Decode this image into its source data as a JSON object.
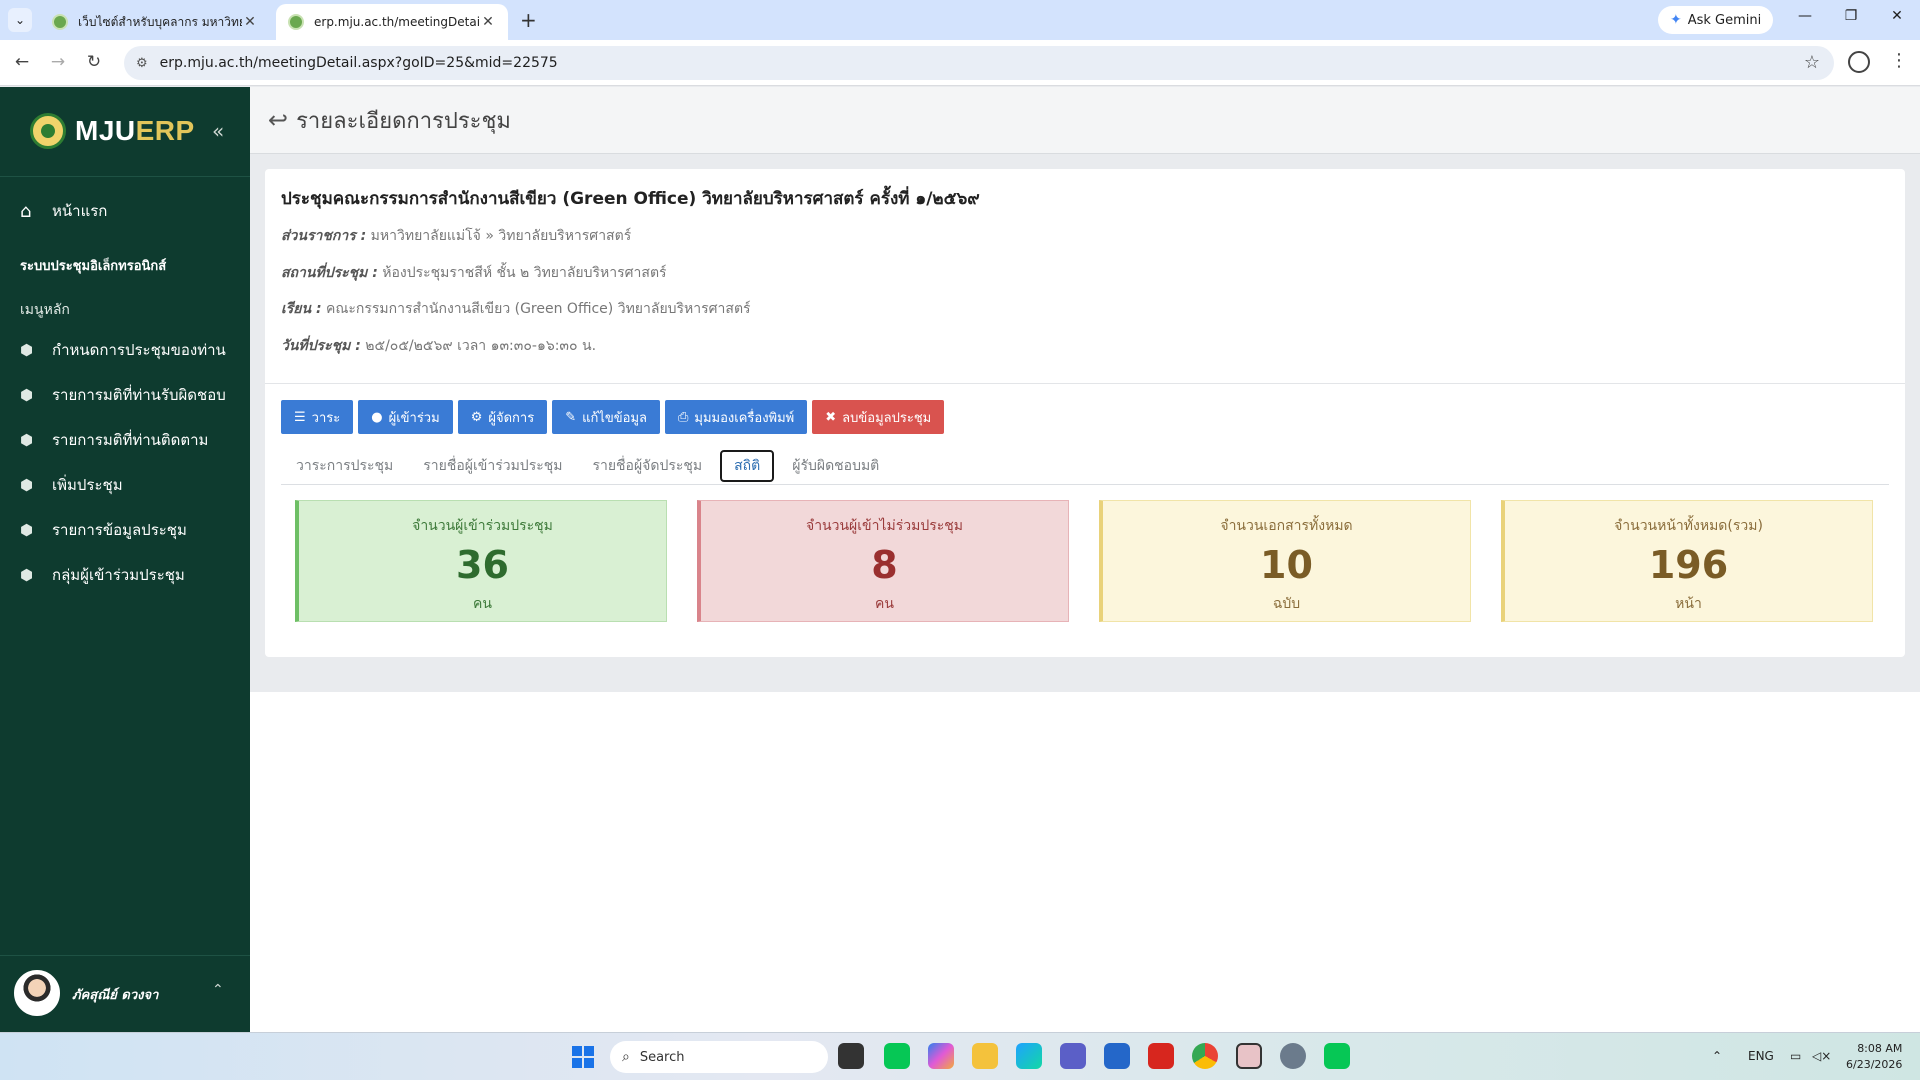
{
  "browser": {
    "tabs": [
      {
        "title": "เว็บไซต์สำหรับบุคลากร มหาวิทยาลัยแม่โจ้"
      },
      {
        "title": "erp.mju.ac.th/meetingDetail.aspx"
      }
    ],
    "url": "erp.mju.ac.th/meetingDetail.aspx?goID=25&mid=22575",
    "ask_gemini": "Ask Gemini"
  },
  "sidebar": {
    "brand_mju": "MJU",
    "brand_erp": "ERP",
    "home": "หน้าแรก",
    "section_title": "ระบบประชุมอิเล็กทรอนิกส์",
    "section_sub": "เมนูหลัก",
    "items": [
      {
        "label": "กำหนดการประชุมของท่าน"
      },
      {
        "label": "รายการมติที่ท่านรับผิดชอบ"
      },
      {
        "label": "รายการมติที่ท่านติดตาม"
      },
      {
        "label": "เพิ่มประชุม"
      },
      {
        "label": "รายการข้อมูลประชุม"
      },
      {
        "label": "กลุ่มผู้เข้าร่วมประชุม"
      }
    ],
    "user_name": "ภัคสุณีย์ ดวงจา"
  },
  "page": {
    "header_title": "รายละเอียดการประชุม"
  },
  "meeting": {
    "title": "ประชุมคณะกรรมการสำนักงานสีเขียว (Green Office) วิทยาลัยบริหารศาสตร์  ครั้งที่ ๑/๒๕๖๙",
    "org_label": "ส่วนราชการ :",
    "org_value": "มหาวิทยาลัยแม่โจ้ » วิทยาลัยบริหารศาสตร์",
    "place_label": "สถานที่ประชุม :",
    "place_value": "ห้องประชุมราชสีห์ ชั้น ๒ วิทยาลัยบริหารศาสตร์",
    "to_label": "เรียน :",
    "to_value": "คณะกรรมการสำนักงานสีเขียว (Green Office) วิทยาลัยบริหารศาสตร์",
    "date_label": "วันที่ประชุม :",
    "date_value": "๒๕/๐๕/๒๕๖๙ เวลา ๑๓:๓๐-๑๖:๓๐ น."
  },
  "actions": [
    {
      "label": "วาระ",
      "icon": "list-icon"
    },
    {
      "label": "ผู้เข้าร่วม",
      "icon": "user-icon"
    },
    {
      "label": "ผู้จัดการ",
      "icon": "gear-icon"
    },
    {
      "label": "แก้ไขข้อมูล",
      "icon": "pencil-icon"
    },
    {
      "label": "มุมมองเครื่องพิมพ์",
      "icon": "printer-icon"
    },
    {
      "label": "ลบข้อมูลประชุม",
      "icon": "close-icon"
    }
  ],
  "subtabs": [
    {
      "label": "วาระการประชุม"
    },
    {
      "label": "รายชื่อผู้เข้าร่วมประชุม"
    },
    {
      "label": "รายชื่อผู้จัดประชุม"
    },
    {
      "label": "สถิติ"
    },
    {
      "label": "ผู้รับผิดชอบมติ"
    }
  ],
  "stats": [
    {
      "label": "จำนวนผู้เข้าร่วมประชุม",
      "value": "36",
      "unit": "คน"
    },
    {
      "label": "จำนวนผู้เข้าไม่ร่วมประชุม",
      "value": "8",
      "unit": "คน"
    },
    {
      "label": "จำนวนเอกสารทั้งหมด",
      "value": "10",
      "unit": "ฉบับ"
    },
    {
      "label": "จำนวนหน้าทั้งหมด(รวม)",
      "value": "196",
      "unit": "หน้า"
    }
  ],
  "taskbar": {
    "search_placeholder": "Search",
    "lang": "ENG",
    "time": "8:08 AM",
    "date": "6/23/2026"
  },
  "colors": {
    "sidebar_bg": "#0e3b2f",
    "button_primary": "#3a7bd5",
    "button_danger": "#d9534f"
  }
}
